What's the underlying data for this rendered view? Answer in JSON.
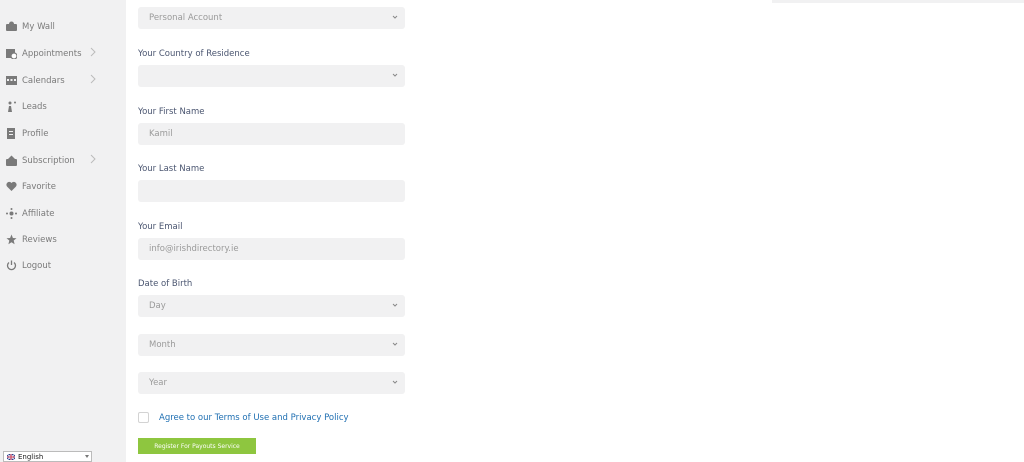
{
  "sidebar": {
    "items": [
      {
        "label": "My Wall",
        "icon": "wall-icon",
        "has_submenu": false
      },
      {
        "label": "Appointments",
        "icon": "appointments-icon",
        "has_submenu": true
      },
      {
        "label": "Calendars",
        "icon": "calendar-icon",
        "has_submenu": true
      },
      {
        "label": "Leads",
        "icon": "leads-icon",
        "has_submenu": false
      },
      {
        "label": "Profile",
        "icon": "profile-icon",
        "has_submenu": false
      },
      {
        "label": "Subscription",
        "icon": "subscription-icon",
        "has_submenu": true
      },
      {
        "label": "Favorite",
        "icon": "heart-icon",
        "has_submenu": false
      },
      {
        "label": "Affiliate",
        "icon": "affiliate-icon",
        "has_submenu": false
      },
      {
        "label": "Reviews",
        "icon": "star-icon",
        "has_submenu": false
      },
      {
        "label": "Logout",
        "icon": "power-icon",
        "has_submenu": false
      }
    ]
  },
  "form": {
    "account_type": {
      "value": "Personal Account"
    },
    "country": {
      "label": "Your Country of Residence",
      "value": ""
    },
    "first_name": {
      "label": "Your First Name",
      "value": "Kamil"
    },
    "last_name": {
      "label": "Your Last Name",
      "value": ""
    },
    "email": {
      "label": "Your Email",
      "value": "info@irishdirectory.ie"
    },
    "dob": {
      "label": "Date of Birth",
      "day": "Day",
      "month": "Month",
      "year": "Year"
    },
    "agree_text": "Agree to our Terms of Use and Privacy Policy",
    "submit_label": "Register For Payouts Service"
  },
  "language": {
    "selected": "English"
  },
  "colors": {
    "accent": "#8ec63f",
    "link": "#1f6fb2",
    "sidebar_bg": "#f1f1f2"
  }
}
